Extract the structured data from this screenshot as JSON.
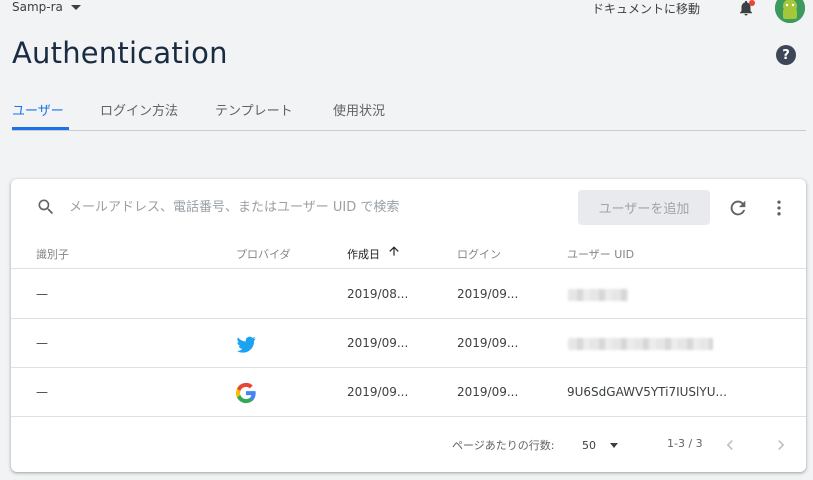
{
  "header": {
    "project_name": "Samp-ra",
    "docs_link": "ドキュメントに移動"
  },
  "page": {
    "title": "Authentication"
  },
  "tabs": [
    {
      "label": "ユーザー",
      "active": true
    },
    {
      "label": "ログイン方法",
      "active": false
    },
    {
      "label": "テンプレート",
      "active": false
    },
    {
      "label": "使用状況",
      "active": false
    }
  ],
  "toolbar": {
    "search_placeholder": "メールアドレス、電話番号、またはユーザー UID で検索",
    "add_user_label": "ユーザーを追加"
  },
  "table": {
    "columns": [
      "識別子",
      "プロバイダ",
      "作成日",
      "ログイン",
      "ユーザー UID"
    ],
    "sorted_column": "作成日",
    "rows": [
      {
        "identifier": "—",
        "provider": "",
        "created": "2019/08...",
        "signed_in": "2019/09...",
        "uid": ""
      },
      {
        "identifier": "—",
        "provider": "twitter-icon",
        "created": "2019/09...",
        "signed_in": "2019/09...",
        "uid": ""
      },
      {
        "identifier": "—",
        "provider": "google-icon",
        "created": "2019/09...",
        "signed_in": "2019/09...",
        "uid": "9U6SdGAWV5YTi7IUSlYU..."
      }
    ]
  },
  "pagination": {
    "rows_per_page_label": "ページあたりの行数:",
    "rows_per_page": "50",
    "range": "1-3 / 3"
  },
  "colors": {
    "accent": "#1a73e8",
    "background": "#f1f3f4",
    "twitter": "#1da1f2"
  }
}
